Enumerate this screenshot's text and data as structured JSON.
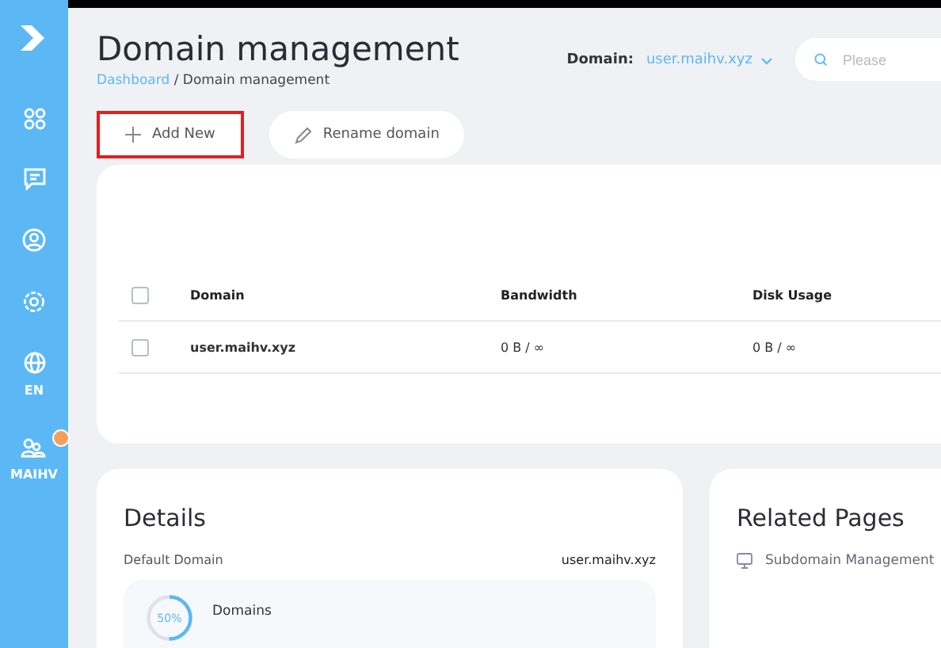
{
  "banner": {
    "shown": true
  },
  "sidebar": {
    "items": [
      {
        "kind": "logo"
      },
      {
        "kind": "grid"
      },
      {
        "kind": "chat"
      },
      {
        "kind": "user"
      },
      {
        "kind": "gear"
      },
      {
        "kind": "language",
        "label": "EN"
      },
      {
        "kind": "account",
        "label": "MAIHV",
        "badge": true
      }
    ]
  },
  "header": {
    "title": "Domain management",
    "breadcrumb": [
      {
        "label": "Dashboard",
        "link": true
      },
      {
        "label": "Domain management",
        "link": false
      }
    ],
    "breadcrumb_separator": "/",
    "domain_label": "Domain:",
    "domain_value": "user.maihv.xyz",
    "search": {
      "placeholder": "Please"
    }
  },
  "toolbar": [
    {
      "label": "Add New",
      "kind": "add",
      "highlighted": true
    },
    {
      "label": "Rename domain",
      "kind": "rename",
      "highlighted": false
    }
  ],
  "table": {
    "header_checked": false,
    "columns": [
      "Domain",
      "Bandwidth",
      "Disk Usage"
    ],
    "rows": [
      {
        "checked": false,
        "cells": [
          "user.maihv.xyz",
          "0 B / ∞",
          "0 B / ∞"
        ]
      }
    ]
  },
  "details": {
    "title": "Details",
    "default_label": "Default Domain",
    "default_value": "user.maihv.xyz",
    "usage": {
      "level": 0.5,
      "percent": "50%",
      "label": "Domains"
    }
  },
  "related": {
    "title": "Related Pages",
    "links": [
      "Subdomain Management"
    ]
  }
}
